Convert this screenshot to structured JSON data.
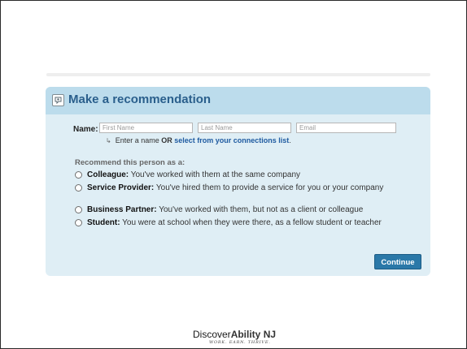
{
  "panel": {
    "title": "Make a recommendation",
    "icon": "recommendation-icon"
  },
  "name_row": {
    "label": "Name:",
    "first_name_placeholder": "First Name",
    "last_name_placeholder": "Last Name",
    "email_placeholder": "Email",
    "first_name_value": "",
    "last_name_value": "",
    "email_value": ""
  },
  "hint": {
    "prefix": "Enter a name",
    "or": "OR",
    "link": "select from your connections list",
    "suffix": "."
  },
  "recommend_label": "Recommend this person as a:",
  "options": [
    {
      "title": "Colleague:",
      "desc": "You've worked with them at the same company"
    },
    {
      "title": "Service Provider:",
      "desc": "You've hired them to provide a service for you or your company"
    },
    {
      "title": "Business Partner:",
      "desc": "You've worked with them, but not as a client or colleague"
    },
    {
      "title": "Student:",
      "desc": "You were at school when they were there, as a fellow student or teacher"
    }
  ],
  "continue_label": "Continue",
  "logo": {
    "part1": "Discover",
    "part2": "Ability NJ",
    "tagline": "WORK. EARN. THRIVE."
  },
  "colors": {
    "panel_bg": "#dfeef5",
    "header_bg": "#bcdcec",
    "title": "#2a5f8c",
    "link": "#1e5aa0",
    "button": "#2a78a8"
  }
}
